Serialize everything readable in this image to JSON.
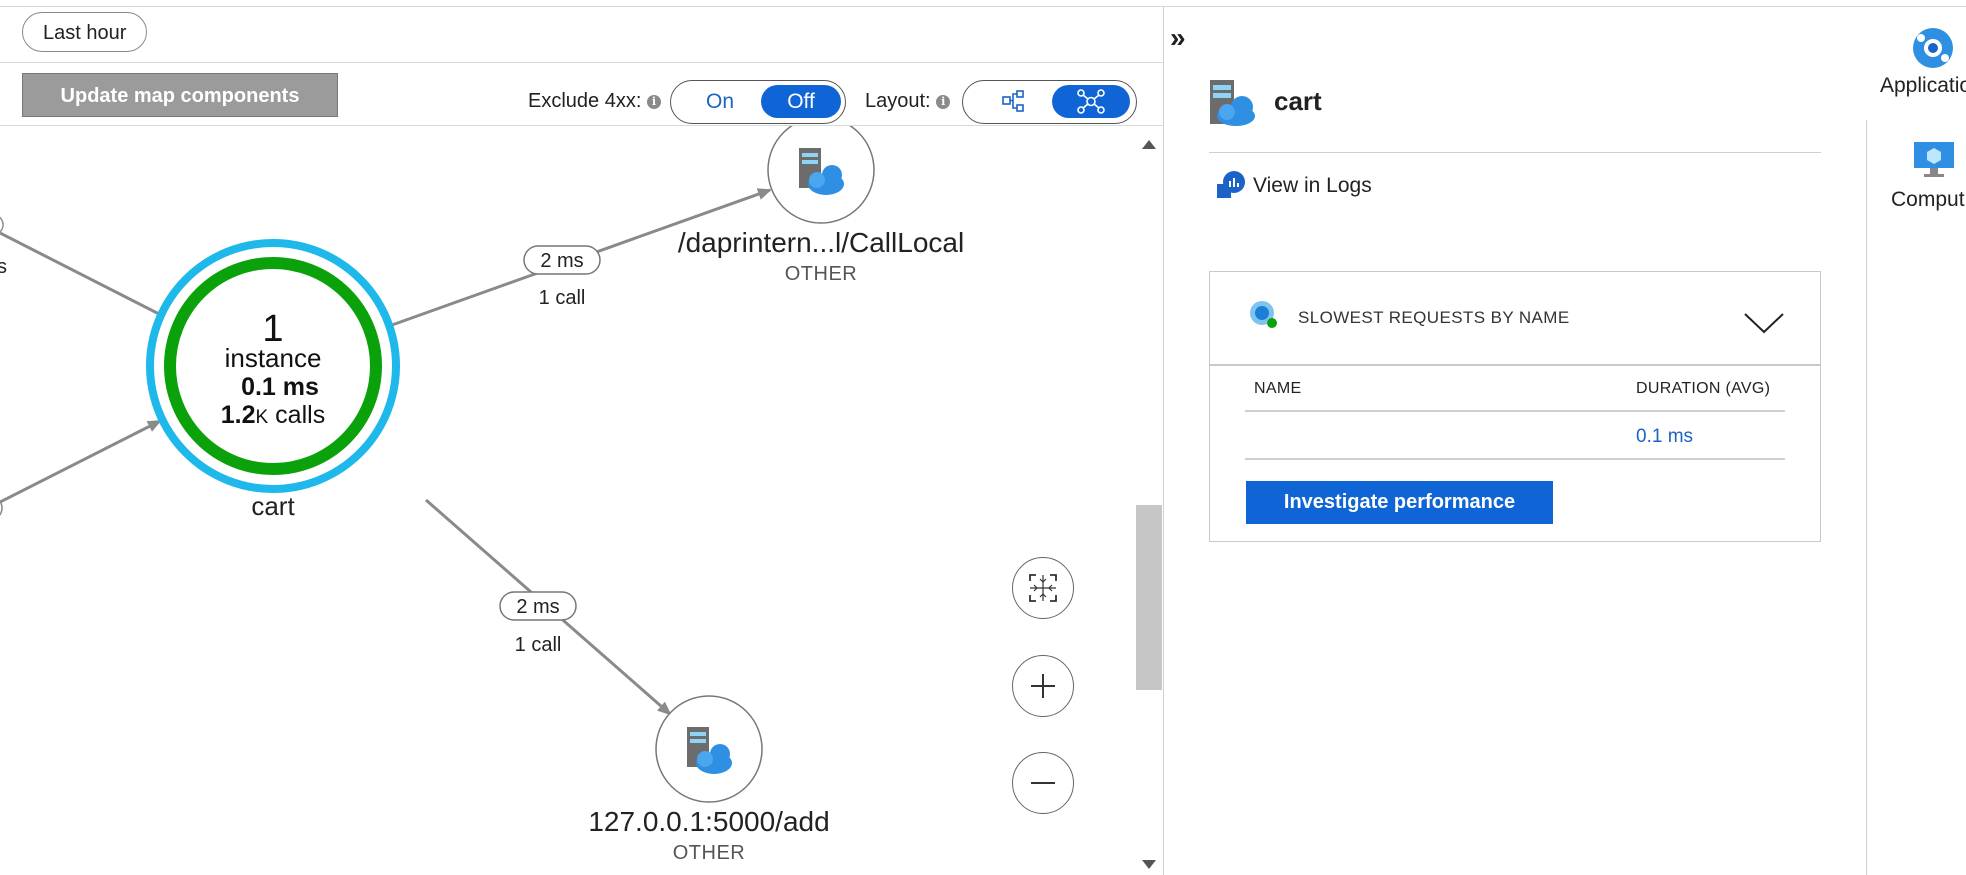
{
  "toolbar": {
    "time_range": "Last hour",
    "update_button": "Update map components",
    "exclude_label": "Exclude 4xx:",
    "exclude_on": "On",
    "exclude_off": "Off",
    "layout_label": "Layout:"
  },
  "map": {
    "center_node": {
      "count": "1",
      "instance_label": "instance",
      "duration": "0.1 ms",
      "calls_value": "1.2",
      "calls_unit": "K",
      "calls_label": " calls",
      "name": "cart"
    },
    "edges": [
      {
        "duration": "2 ms",
        "calls": "1 call"
      },
      {
        "duration": "2 ms",
        "calls": "1 call"
      }
    ],
    "partial_left_labels": [
      "s"
    ],
    "nodes": [
      {
        "name": "/daprintern...l/CallLocal",
        "type": "OTHER"
      },
      {
        "name": "127.0.0.1:5000/add",
        "type": "OTHER"
      }
    ]
  },
  "details": {
    "collapse_glyph": "»",
    "title": "cart",
    "view_logs": "View in Logs",
    "card": {
      "title": "SLOWEST REQUESTS BY NAME",
      "col_name": "NAME",
      "col_duration": "DURATION (AVG)",
      "rows": [
        {
          "name": "",
          "duration": "0.1 ms"
        }
      ],
      "investigate_button": "Investigate performance"
    }
  },
  "side_nav": {
    "items": [
      {
        "label": "Applicatio",
        "icon": "application-insights-icon"
      },
      {
        "label": "Comput",
        "icon": "compute-icon"
      }
    ]
  },
  "colors": {
    "accent": "#0f64d6",
    "node_ring_outer": "#1eb8ea",
    "node_ring_inner": "#0aa10a",
    "link": "#1b63c6"
  }
}
